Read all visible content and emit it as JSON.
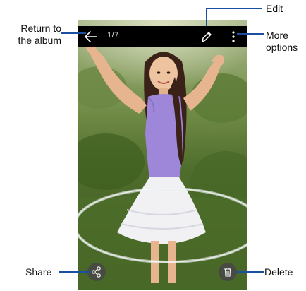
{
  "viewer": {
    "counter": "1/7",
    "icons": {
      "back": "arrow-left-icon",
      "edit": "pencil-icon",
      "more": "vertical-dots-icon",
      "share": "share-icon",
      "delete": "trash-icon"
    },
    "colors": {
      "top_bar": "#000000",
      "icon": "#ffffff",
      "round_button": "#464646",
      "callout_line": "#1b4fa0"
    }
  },
  "callouts": {
    "return_line1": "Return to",
    "return_line2": "the album",
    "edit": "Edit",
    "more_line1": "More",
    "more_line2": "options",
    "share": "Share",
    "delete": "Delete"
  }
}
